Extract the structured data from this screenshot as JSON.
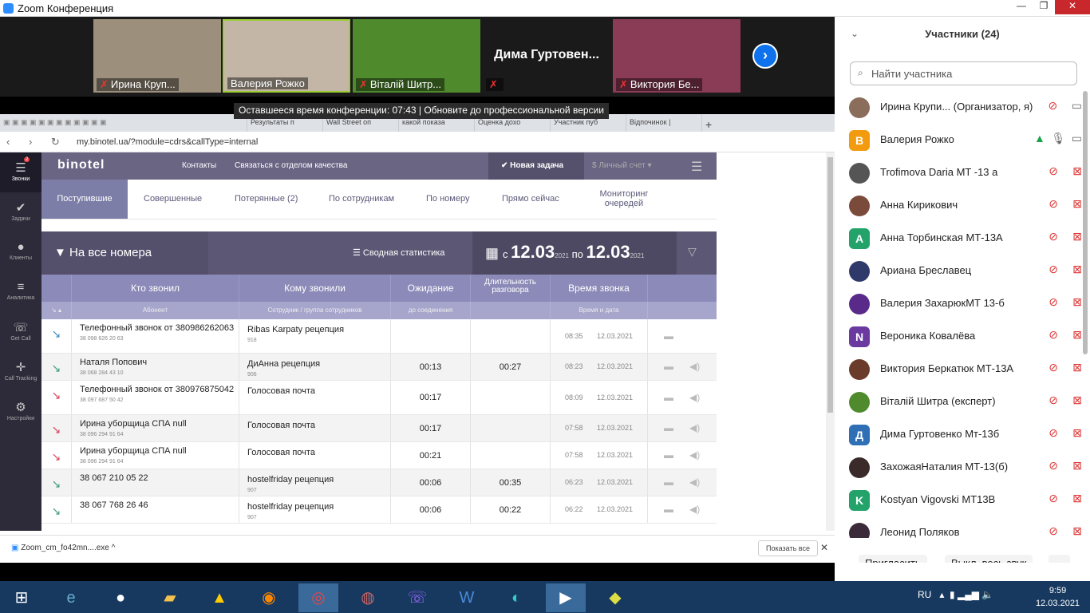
{
  "window": {
    "title": "Zoom Конференция",
    "min": "—",
    "max": "❐",
    "close": "✕"
  },
  "video": {
    "tiles": [
      {
        "name": "Ирина Круп...",
        "muted": true,
        "bg": "#9c8f7c"
      },
      {
        "name": "Валерия Рожко",
        "muted": false,
        "bg": "#c4b6a6",
        "active": true
      },
      {
        "name": "Віталій Шитр...",
        "muted": true,
        "bg": "#4f8a2c"
      },
      {
        "name": "",
        "label": "Дима Гуртовен...",
        "muted": true,
        "bg": "#1a1a1a"
      },
      {
        "name": "Виктория Бе...",
        "muted": true,
        "bg": "#8a3b56"
      }
    ],
    "next": "›",
    "notice": "Оставшееся время конференции: 07:43 | Обновите до профессиональной версии"
  },
  "browser": {
    "tabs": [
      "Результаты п",
      "Wall Street оп",
      "какой показа",
      "Оценка дохо",
      "Участник пуб",
      "Відпочинок |"
    ],
    "url": "my.binotel.ua/?module=cdrs&callType=internal",
    "nav": "‹ › ↻"
  },
  "sidebar": [
    {
      "label": "Звонки",
      "icon": "☰",
      "badge": "2",
      "on": true
    },
    {
      "label": "Задачи",
      "icon": "✔"
    },
    {
      "label": "Клиенты",
      "icon": "●"
    },
    {
      "label": "Аналитика",
      "icon": "≡"
    },
    {
      "label": "Get Call",
      "icon": "☏"
    },
    {
      "label": "Call Tracking",
      "icon": "✛"
    },
    {
      "label": "Настройки",
      "icon": "⚙"
    }
  ],
  "topnav": {
    "logo": "binotel",
    "contacts": "Контакты",
    "quality": "Связаться с отделом качества",
    "new_task": "Новая задача",
    "account": "Личный счет"
  },
  "subtabs": [
    "Поступившие",
    "Совершенные",
    "Потерянные (2)",
    "По сотрудникам",
    "По номеру",
    "Прямо сейчас",
    "Мониторинг очередей"
  ],
  "filter": {
    "all_numbers": "На все номера",
    "stats": "Сводная статистика",
    "from": "с",
    "to": "по",
    "date1": "12.03",
    "date2": "12.03",
    "year": "2021"
  },
  "table": {
    "headers": [
      "Кто звонил",
      "Кому звонили",
      "Ожидание",
      "Длительность разговора",
      "Время звонка"
    ],
    "subheaders": [
      "Абонент",
      "Сотрудник / группа сотрудников",
      "до соединения",
      "",
      "Время и дата"
    ],
    "rows": [
      {
        "dir": "in",
        "caller": "Телефонный звонок от 380986262063",
        "caller_sub": "38 098 626 20 63",
        "callee": "Ribas Karpaty рецепция",
        "callee_sub": "918",
        "wait": "",
        "dur": "",
        "time": "08:35",
        "date": "12.03.2021",
        "sound": false
      },
      {
        "dir": "ok",
        "caller": "Наталя Попович",
        "caller_sub": "38 068 284 43 10",
        "callee": "ДиАнна рецепция",
        "callee_sub": "906",
        "wait": "00:13",
        "dur": "00:27",
        "time": "08:23",
        "date": "12.03.2021",
        "sound": true
      },
      {
        "dir": "miss",
        "caller": "Телефонный звонок от 380976875042",
        "caller_sub": "38 097 687 50 42",
        "callee": "Голосовая почта",
        "callee_sub": "",
        "wait": "00:17",
        "dur": "",
        "time": "08:09",
        "date": "12.03.2021",
        "sound": true
      },
      {
        "dir": "miss",
        "caller": "Ирина уборщица СПА null",
        "caller_sub": "38 096 294 91 64",
        "callee": "Голосовая почта",
        "callee_sub": "",
        "wait": "00:17",
        "dur": "",
        "time": "07:58",
        "date": "12.03.2021",
        "sound": true
      },
      {
        "dir": "miss",
        "caller": "Ирина уборщица СПА null",
        "caller_sub": "38 096 294 91 64",
        "callee": "Голосовая почта",
        "callee_sub": "",
        "wait": "00:21",
        "dur": "",
        "time": "07:58",
        "date": "12.03.2021",
        "sound": true
      },
      {
        "dir": "ok",
        "caller": "38 067 210 05 22",
        "caller_sub": "",
        "callee": "hostelfriday рецепция",
        "callee_sub": "907",
        "wait": "00:06",
        "dur": "00:35",
        "time": "06:23",
        "date": "12.03.2021",
        "sound": true
      },
      {
        "dir": "ok",
        "caller": "38 067 768 26 46",
        "caller_sub": "",
        "callee": "hostelfriday рецепция",
        "callee_sub": "907",
        "wait": "00:06",
        "dur": "00:22",
        "time": "06:22",
        "date": "12.03.2021",
        "sound": true
      }
    ]
  },
  "download": {
    "file": "Zoom_cm_fo42mn....exe",
    "show_all": "Показать все"
  },
  "participants": {
    "header": "Участники (24)",
    "search_placeholder": "Найти участника",
    "list": [
      {
        "name": "Ирина Крупи...  (Организатор, я)",
        "initial": "",
        "color": "#8a6d5a",
        "muted": true,
        "video_off": false
      },
      {
        "name": "Валерия Рожко",
        "initial": "В",
        "color": "#f29b0f",
        "muted": false,
        "video_off": false
      },
      {
        "name": "Trofimova Daria MT -13 a",
        "initial": "",
        "color": "#555",
        "muted": true,
        "video_off": true
      },
      {
        "name": "Анна Кирикович",
        "initial": "",
        "color": "#7a4a3a",
        "muted": true,
        "video_off": true
      },
      {
        "name": "Анна Торбинская МТ-13А",
        "initial": "А",
        "color": "#23a36a",
        "muted": true,
        "video_off": true
      },
      {
        "name": "Ариана Бреславец",
        "initial": "",
        "color": "#2f3a6a",
        "muted": true,
        "video_off": true
      },
      {
        "name": "Валерия ЗахарюкМТ 13-б",
        "initial": "",
        "color": "#5a2a8a",
        "muted": true,
        "video_off": true
      },
      {
        "name": "Вероника Ковалёва",
        "initial": "N",
        "color": "#6a3aa0",
        "muted": true,
        "video_off": true
      },
      {
        "name": "Виктория Беркатюк МТ-13А",
        "initial": "",
        "color": "#6a3a2a",
        "muted": true,
        "video_off": true
      },
      {
        "name": "Віталій Шитра (експерт)",
        "initial": "",
        "color": "#4f8a2c",
        "muted": true,
        "video_off": true
      },
      {
        "name": "Дима Гуртовенко Мт-13б",
        "initial": "Д",
        "color": "#2f6fb5",
        "muted": true,
        "video_off": true
      },
      {
        "name": "ЗахожаяНаталия МТ-13(б)",
        "initial": "",
        "color": "#3a2a2a",
        "muted": true,
        "video_off": true
      },
      {
        "name": "Kostyan Vigovski MT13B",
        "initial": "K",
        "color": "#23a36a",
        "muted": true,
        "video_off": true
      },
      {
        "name": "Леонид Поляков",
        "initial": "",
        "color": "#3a2a3a",
        "muted": true,
        "video_off": true
      }
    ],
    "invite": "Пригласить",
    "mute_all": "Выкл. весь звук",
    "more": "..."
  },
  "taskbar": {
    "lang": "RU",
    "time": "9:59",
    "date": "12.03.2021"
  }
}
